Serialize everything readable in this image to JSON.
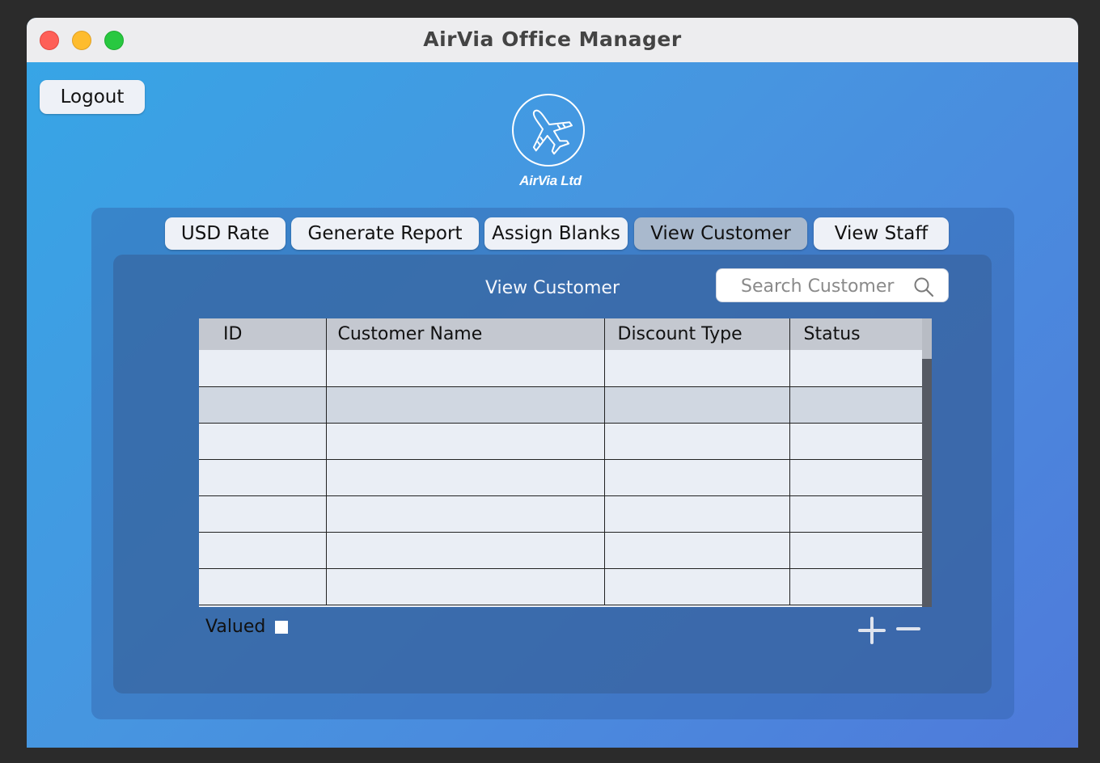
{
  "window": {
    "title": "AirVia Office Manager"
  },
  "logout_label": "Logout",
  "logo": {
    "caption": "AirVia Ltd"
  },
  "tabs": [
    {
      "label": "USD Rate"
    },
    {
      "label": "Generate Report"
    },
    {
      "label": "Assign Blanks"
    },
    {
      "label": "View Customer",
      "active": true
    },
    {
      "label": "View Staff"
    }
  ],
  "view": {
    "title": "View Customer",
    "search_placeholder": "Search Customer"
  },
  "table": {
    "columns": [
      "ID",
      "Customer Name",
      "Discount Type",
      "Status"
    ],
    "rows": [
      [
        "",
        "",
        "",
        ""
      ],
      [
        "",
        "",
        "",
        ""
      ],
      [
        "",
        "",
        "",
        ""
      ],
      [
        "",
        "",
        "",
        ""
      ],
      [
        "",
        "",
        "",
        ""
      ],
      [
        "",
        "",
        "",
        ""
      ],
      [
        "",
        "",
        "",
        ""
      ]
    ]
  },
  "valued_label": "Valued",
  "icons": {
    "search": "search-icon",
    "add": "plus-icon",
    "remove": "minus-icon",
    "logo": "airplane-icon"
  },
  "colors": {
    "active_tab": "#a9b9cd",
    "window_gradient_start": "#36a6e6",
    "window_gradient_end": "#4f7ada"
  }
}
